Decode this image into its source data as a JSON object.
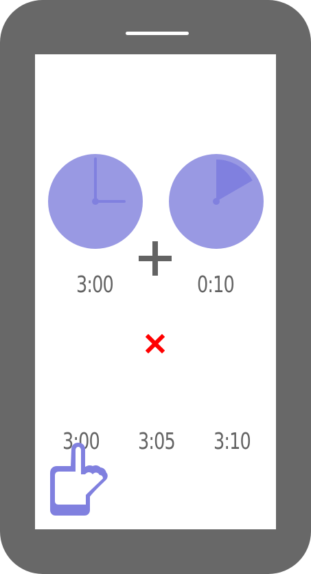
{
  "colors": {
    "phone_frame": "#686868",
    "screen": "#ffffff",
    "clock_face": "#9999e3",
    "clock_accent": "#8080df",
    "operator_gray": "#636363",
    "cross_red": "#ff0000"
  },
  "clocks": [
    {
      "label": "3:00",
      "icon": "clock-three-oclock-icon"
    },
    {
      "label": "0:10",
      "icon": "elapsed-ten-minutes-icon"
    }
  ],
  "operators": {
    "plus": "plus-icon",
    "cross": "cross-icon"
  },
  "choices": [
    {
      "label": "3:00"
    },
    {
      "label": "3:05"
    },
    {
      "label": "3:10"
    }
  ],
  "pointer": {
    "icon": "pointing-hand-icon"
  }
}
